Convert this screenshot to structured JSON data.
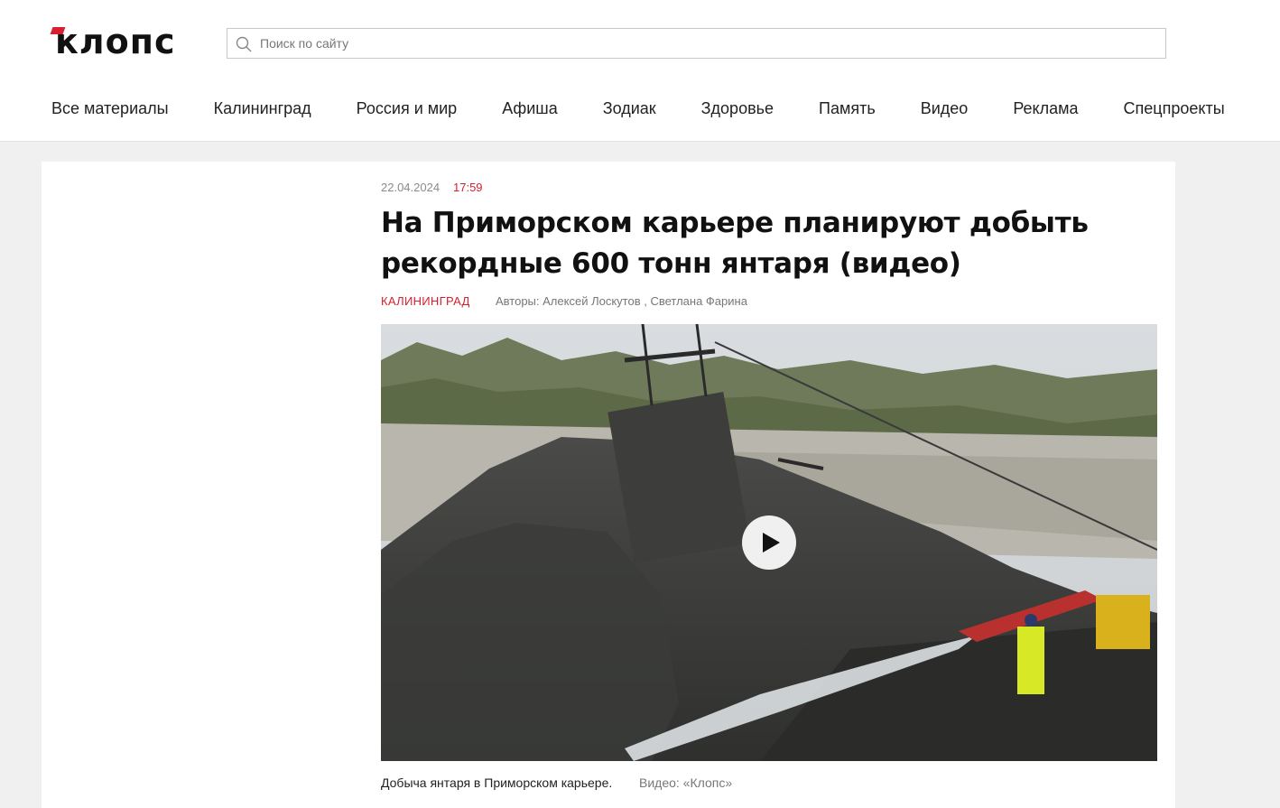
{
  "site": {
    "logo_text": "клопс",
    "brand_color": "#d6202f"
  },
  "search": {
    "placeholder": "Поиск по сайту",
    "value": ""
  },
  "nav": {
    "items": [
      "Все материалы",
      "Калининград",
      "Россия и мир",
      "Афиша",
      "Зодиак",
      "Здоровье",
      "Память",
      "Видео",
      "Реклама",
      "Спецпроекты"
    ]
  },
  "article": {
    "date": "22.04.2024",
    "time": "17:59",
    "title": "На Приморском карьере планируют добыть рекордные 600 тонн янтаря (видео)",
    "rubric": "Калининград",
    "authors_label": "Авторы:",
    "author_1": "Алексей Лоскутов",
    "author_separator": " , ",
    "author_2": "Светлана Фарина",
    "video": {
      "icon": "play-icon"
    },
    "caption": "Добыча янтаря в Приморском карьере.",
    "caption_credit": "Видео: «Клопс»"
  }
}
